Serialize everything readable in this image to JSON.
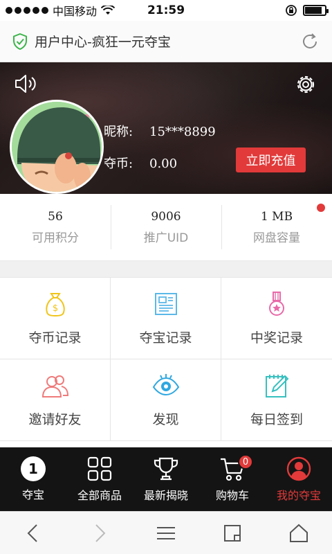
{
  "status_bar": {
    "carrier": "中国移动",
    "time": "21:59",
    "battery_level": 0.85
  },
  "address_bar": {
    "title": "用户中心-疯狂一元夺宝"
  },
  "profile": {
    "nickname_label": "昵称:",
    "nickname_value": "15***8899",
    "coins_label": "夺币:",
    "coins_value": "0.00",
    "recharge_label": "立即充值"
  },
  "stats": [
    {
      "value": "56",
      "label": "可用积分"
    },
    {
      "value": "9006",
      "label": "推广UID"
    },
    {
      "value": "1 MB",
      "label": "网盘容量"
    }
  ],
  "grid": [
    {
      "label": "夺币记录",
      "icon": "money-bag-icon",
      "color": "#f0c419"
    },
    {
      "label": "夺宝记录",
      "icon": "document-icon",
      "color": "#5bb8e8"
    },
    {
      "label": "中奖记录",
      "icon": "medal-icon",
      "color": "#e86aa8"
    },
    {
      "label": "邀请好友",
      "icon": "users-icon",
      "color": "#ef7a7a"
    },
    {
      "label": "发现",
      "icon": "eye-icon",
      "color": "#2fa8e0"
    },
    {
      "label": "每日签到",
      "icon": "notepad-icon",
      "color": "#37c0c0"
    }
  ],
  "bottom_nav": [
    {
      "label": "夺宝",
      "icon": "number-one-icon",
      "number": "1"
    },
    {
      "label": "全部商品",
      "icon": "grid-icon"
    },
    {
      "label": "最新揭晓",
      "icon": "trophy-icon"
    },
    {
      "label": "购物车",
      "icon": "cart-icon",
      "badge": "0"
    },
    {
      "label": "我的夺宝",
      "icon": "user-circle-icon",
      "active": true
    }
  ],
  "colors": {
    "accent": "#e23a3a"
  }
}
